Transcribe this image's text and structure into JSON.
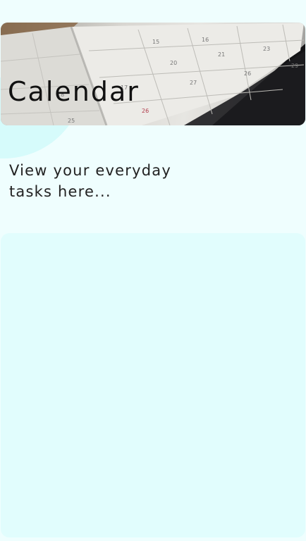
{
  "header": {
    "title": "Calendar",
    "image": "calendar-photo"
  },
  "intro": {
    "text": "View your everyday tasks here..."
  },
  "panel": {
    "content": ""
  },
  "colors": {
    "background": "#effefe",
    "panel": "#e1fdfd",
    "blob": "#d6fbfb",
    "text": "#111111"
  }
}
